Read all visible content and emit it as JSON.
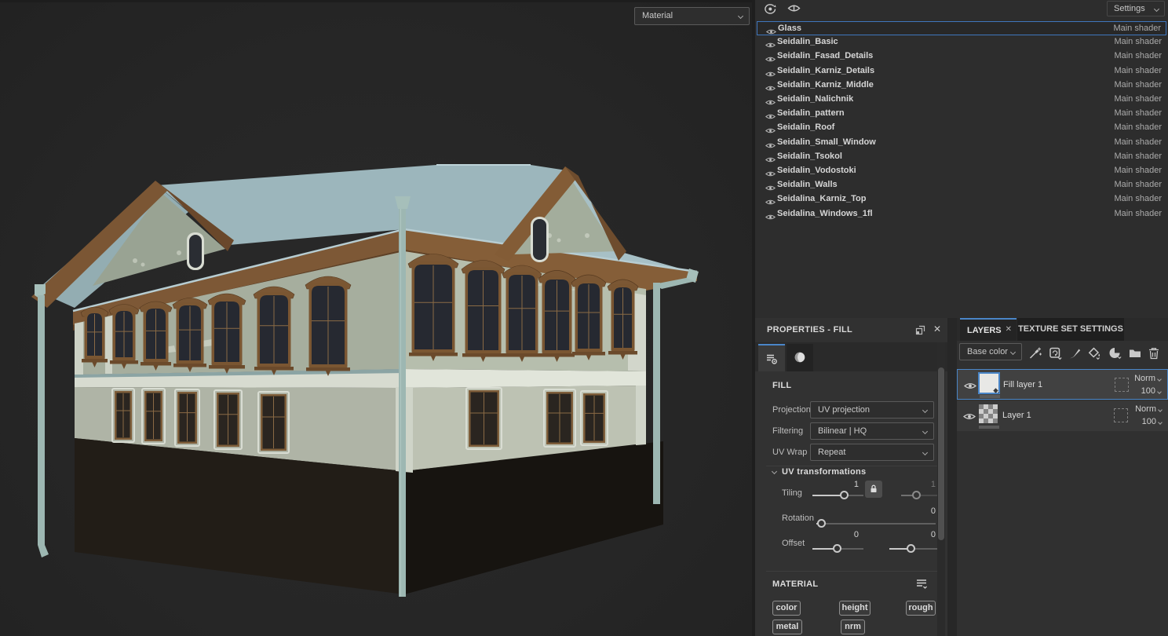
{
  "viewport": {
    "display_mode_label": "Material"
  },
  "texture_set_list": {
    "settings_label": "Settings",
    "shader_label": "Main shader",
    "selected_item": "Glass",
    "items": [
      "Glass",
      "Seidalin_Basic",
      "Seidalin_Fasad_Details",
      "Seidalin_Karniz_Details",
      "Seidalin_Karniz_Middle",
      "Seidalin_Nalichnik",
      "Seidalin_pattern",
      "Seidalin_Roof",
      "Seidalin_Small_Window",
      "Seidalin_Tsokol",
      "Seidalin_Vodostoki",
      "Seidalin_Walls",
      "Seidalina_Karniz_Top",
      "Seidalina_Windows_1fl"
    ]
  },
  "properties_panel": {
    "title": "PROPERTIES - FILL",
    "fill_section_title": "FILL",
    "fields": [
      {
        "label": "Projection",
        "value": "UV projection"
      },
      {
        "label": "Filtering",
        "value": "Bilinear | HQ"
      },
      {
        "label": "UV Wrap",
        "value": "Repeat"
      }
    ],
    "uv_section_title": "UV transformations",
    "tiling": {
      "label": "Tiling",
      "x_value": "1",
      "y_value": "1",
      "linked": true
    },
    "rotation": {
      "label": "Rotation",
      "value": "0"
    },
    "offset": {
      "label": "Offset",
      "x_value": "0",
      "y_value": "0"
    },
    "material_section_title": "MATERIAL",
    "channels": [
      "color",
      "height",
      "rough",
      "metal",
      "nrm"
    ]
  },
  "layers_panel": {
    "tabs": [
      {
        "label": "LAYERS"
      },
      {
        "label": "TEXTURE SET SETTINGS"
      }
    ],
    "active_tab": "LAYERS",
    "channel_filter": "Base color",
    "layers": [
      {
        "name": "Fill layer 1",
        "blend_mode": "Norm",
        "opacity": "100",
        "selected": true,
        "type": "fill"
      },
      {
        "name": "Layer 1",
        "blend_mode": "Norm",
        "opacity": "100",
        "selected": false,
        "type": "paint"
      }
    ]
  },
  "colors": {
    "accent_blue": "#4a86c8",
    "roof_blue": "#9cb6bc",
    "wall_green": "#a6ae9e",
    "wood_brown": "#7b5734"
  }
}
